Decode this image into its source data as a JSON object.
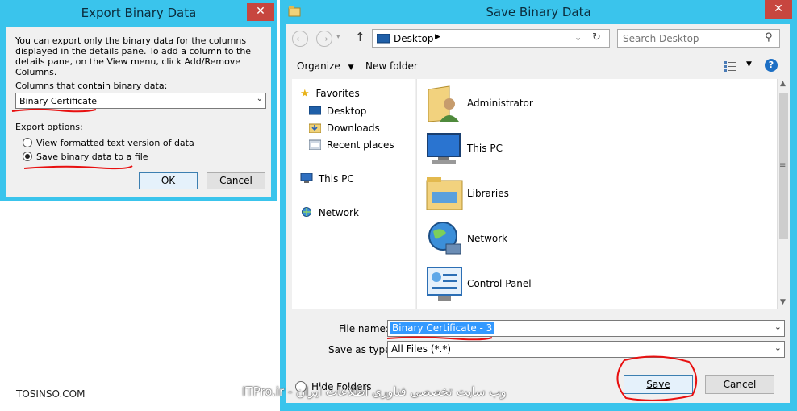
{
  "export_dialog": {
    "title": "Export Binary Data",
    "close_glyph": "✕",
    "description": "You can export only the binary data for the columns displayed in the details pane. To add a column to the details pane, on the View menu, click Add/Remove Columns.",
    "columns_label": "Columns that contain binary data:",
    "columns_value": "Binary Certificate",
    "export_options_label": "Export options:",
    "option_text": "View formatted text version of data",
    "option_file": "Save binary data to a file",
    "ok_label": "OK",
    "cancel_label": "Cancel"
  },
  "save_dialog": {
    "title": "Save Binary Data",
    "close_glyph": "✕",
    "address_location": "Desktop",
    "search_placeholder": "Search Desktop",
    "organize_label": "Organize",
    "new_folder_label": "New folder",
    "help_glyph": "?",
    "nav": {
      "favorites_label": "Favorites",
      "favorites": [
        "Desktop",
        "Downloads",
        "Recent places"
      ],
      "this_pc_label": "This PC",
      "network_label": "Network"
    },
    "items": [
      "Administrator",
      "This PC",
      "Libraries",
      "Network",
      "Control Panel"
    ],
    "file_name_label": "File name:",
    "file_name_value": "Binary Certificate - 3",
    "save_type_label": "Save as type:",
    "save_type_value": "All Files (*.*)",
    "hide_folders_label": "Hide Folders",
    "save_label": "Save",
    "cancel_label": "Cancel"
  },
  "watermarks": {
    "left": "TOSINSO.COM",
    "center": "ITPro.ir - وب سایت تخصصی فناوری اطلاعات ایران"
  },
  "colors": {
    "frame": "#3ac4ec",
    "close": "#c7463f",
    "selection": "#3399ff",
    "annotation": "#e81010"
  }
}
